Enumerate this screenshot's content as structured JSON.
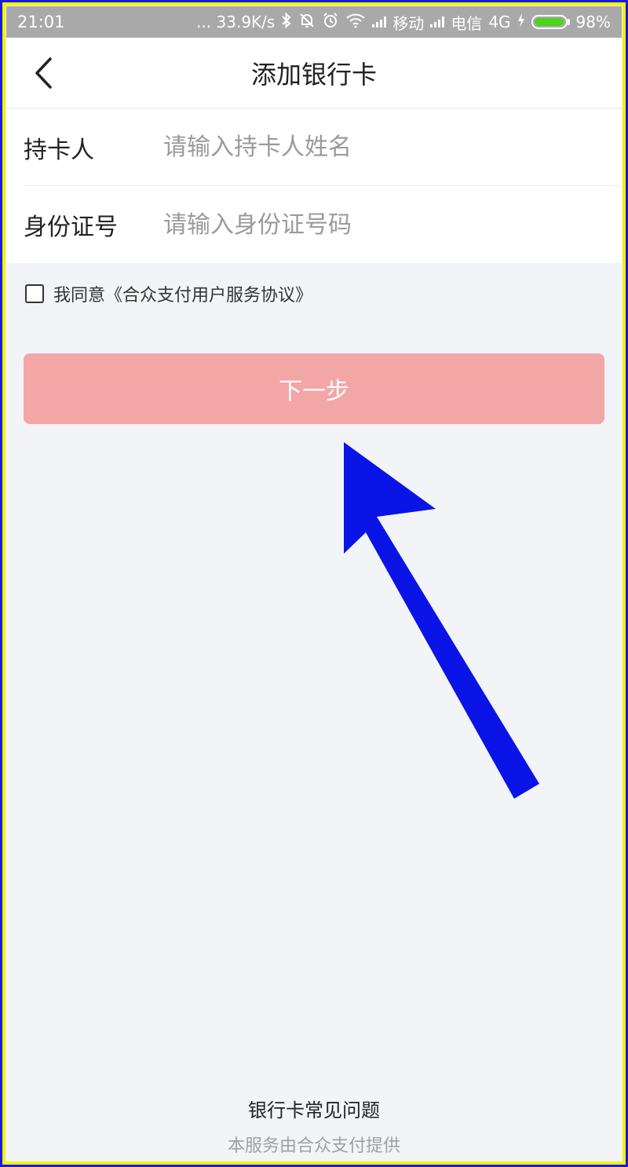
{
  "status_bar": {
    "time": "21:01",
    "speed": "... 33.9K/s",
    "carrier1": "移动",
    "carrier2": "电信",
    "network": "4G",
    "battery": "98%",
    "battery_level": 0.98,
    "icons": [
      "bluetooth-icon",
      "mute-bell-icon",
      "alarm-icon",
      "wifi-icon",
      "signal-icon",
      "charging-icon",
      "battery-icon"
    ]
  },
  "header": {
    "title": "添加银行卡",
    "back_icon": "chevron-left-icon"
  },
  "form": {
    "holder_label": "持卡人",
    "holder_placeholder": "请输入持卡人姓名",
    "id_label": "身份证号",
    "id_placeholder": "请输入身份证号码"
  },
  "agreement": {
    "text": "我同意《合众支付用户服务协议》",
    "checked": false
  },
  "next_button": {
    "label": "下一步"
  },
  "footer": {
    "faq": "银行卡常见问题",
    "provider": "本服务由合众支付提供"
  },
  "colors": {
    "button_bg": "#f3a6a6",
    "annotation_arrow": "#0a14e6",
    "background": "#f2f4f7",
    "status_bar": "#a9a9a9",
    "battery_fill": "#4cd41e"
  }
}
